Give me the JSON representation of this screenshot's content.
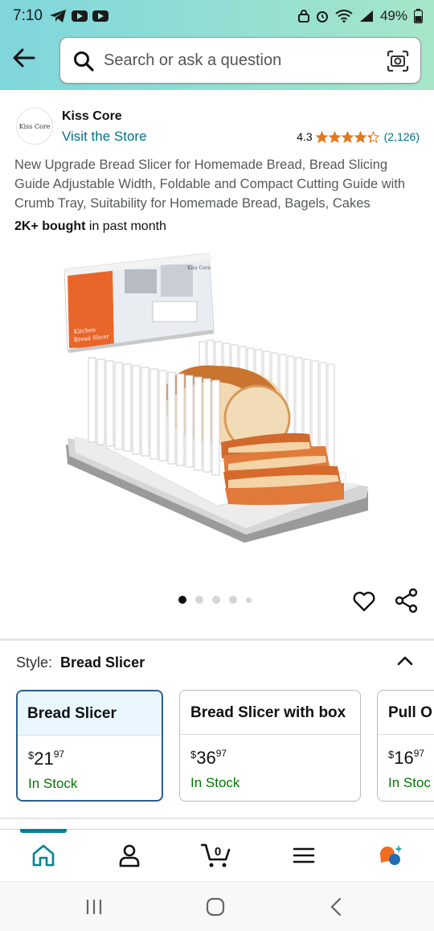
{
  "status_bar": {
    "time": "7:10",
    "battery": "49%"
  },
  "search": {
    "placeholder": "Search or ask a question"
  },
  "seller": {
    "logo_text": "Kiss Core",
    "name": "Kiss Core",
    "visit_label": "Visit the Store"
  },
  "rating": {
    "value": "4.3",
    "count": "(2,126)",
    "stars": 4.3
  },
  "product": {
    "title": "New Upgrade Bread Slicer for Homemade Bread, Bread Slicing Guide Adjustable Width, Foldable and Compact Cutting Guide with Crumb Tray, Suitability for Homemade Bread, Bagels, Cakes",
    "bought_bold": "2K+ bought",
    "bought_rest": " in past month",
    "box_text_1": "Kitchen",
    "box_text_2": "Bread Slicer",
    "box_brand": "Kiss Core",
    "carousel": {
      "count": 5,
      "active": 1
    }
  },
  "style": {
    "label": "Style:",
    "value": "Bread Slicer"
  },
  "options": [
    {
      "name": "Bread Slicer",
      "price_symbol": "$",
      "price_whole": "21",
      "price_frac": "97",
      "stock": "In Stock",
      "selected": true
    },
    {
      "name": "Bread Slicer with box",
      "price_symbol": "$",
      "price_whole": "36",
      "price_frac": "97",
      "stock": "In Stock",
      "selected": false
    },
    {
      "name": "Pull O",
      "price_symbol": "$",
      "price_whole": "16",
      "price_frac": "97",
      "stock": "In Stoc",
      "selected": false
    }
  ],
  "nav": {
    "cart_count": "0",
    "items": [
      "home-icon",
      "account-icon",
      "cart-icon",
      "menu-icon",
      "rufus-icon"
    ]
  },
  "colors": {
    "accent": "#008296",
    "link": "#007185",
    "in_stock": "#007600",
    "star": "#de7921",
    "selected_border": "#2b5e8e"
  }
}
